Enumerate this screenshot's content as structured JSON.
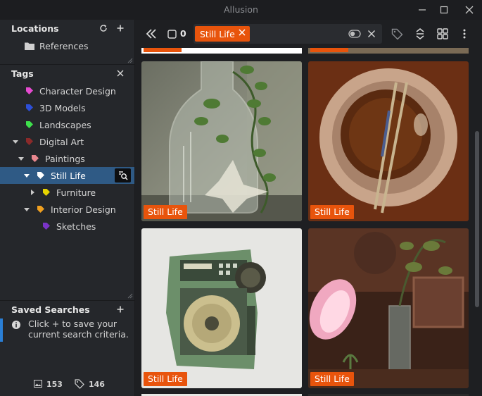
{
  "app": {
    "title": "Allusion"
  },
  "sidebar": {
    "locations": {
      "header": "Locations",
      "items": [
        {
          "label": "References"
        }
      ]
    },
    "tags": {
      "header": "Tags",
      "items": [
        {
          "label": "Character Design",
          "color": "#e64bd0"
        },
        {
          "label": "3D Models",
          "color": "#2d4fd8"
        },
        {
          "label": "Landscapes",
          "color": "#3ee04c"
        },
        {
          "label": "Digital Art",
          "color": "#8b2a2a"
        },
        {
          "label": "Paintings",
          "color": "#e8878f"
        },
        {
          "label": "Still Life",
          "color": "#ffffff"
        },
        {
          "label": "Furniture",
          "color": "#e6d400"
        },
        {
          "label": "Interior Design",
          "color": "#f0a020"
        },
        {
          "label": "Sketches",
          "color": "#7a34c8"
        }
      ]
    },
    "saved_searches": {
      "header": "Saved Searches",
      "empty_message": "Click + to save your current search criteria."
    },
    "stats": {
      "images": "153",
      "tags": "146"
    }
  },
  "toolbar": {
    "selection_count": "0",
    "search_chip": "Still Life"
  },
  "gallery": {
    "cards": [
      {
        "label": "Still Life",
        "subject": "glass-bottle-with-ivy"
      },
      {
        "label": "Still Life",
        "subject": "bowl-with-chopsticks"
      },
      {
        "label": "Still Life",
        "subject": "vintage-radio-cassette"
      },
      {
        "label": "Still Life",
        "subject": "pink-lamp-and-plants"
      }
    ]
  },
  "colors": {
    "accent": "#e8540c",
    "selected_row": "#2f5a85",
    "info_accent": "#2a7fd6"
  }
}
